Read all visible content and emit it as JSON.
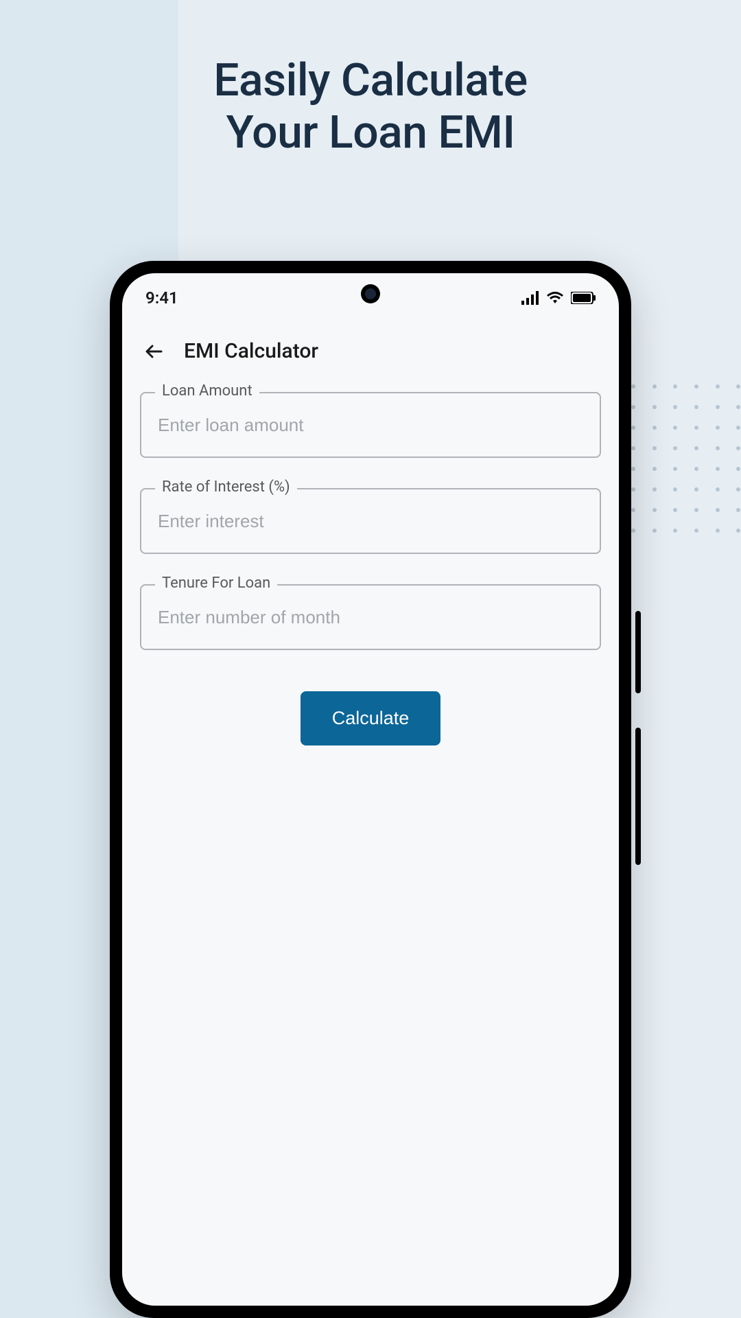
{
  "hero": {
    "line1": "Easily Calculate",
    "line2": "Your Loan EMI"
  },
  "status_bar": {
    "time": "9:41"
  },
  "header": {
    "title": "EMI Calculator"
  },
  "form": {
    "loan_amount": {
      "label": "Loan Amount",
      "placeholder": "Enter loan amount",
      "value": ""
    },
    "rate": {
      "label": "Rate of Interest (%)",
      "placeholder": "Enter interest",
      "value": ""
    },
    "tenure": {
      "label": "Tenure For Loan",
      "placeholder": "Enter number of month",
      "value": ""
    },
    "submit_label": "Calculate"
  },
  "colors": {
    "primary": "#0c6698",
    "text_dark": "#1a2e44"
  }
}
